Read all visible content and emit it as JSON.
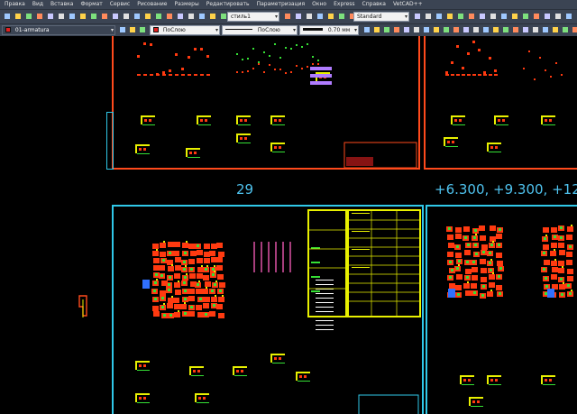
{
  "menu": [
    "Правка",
    "Вид",
    "Вставка",
    "Формат",
    "Сервис",
    "Рисование",
    "Размеры",
    "Редактировать",
    "Параметризация",
    "Окно",
    "Express",
    "Справка",
    "VetCAD++"
  ],
  "toolbar1": {
    "style_combo": "стиль1",
    "standard_combo": "Standard"
  },
  "toolbar2": {
    "layer_combo": "01-armatura",
    "color_combo": "ПоСлою",
    "linetype_combo": "ПоСлою",
    "lineweight_combo": "0.70 мм"
  },
  "drawing": {
    "label_sheet_number": "29",
    "label_elevations": "+6.300, +9.300, +12."
  },
  "colors": {
    "ui_bg": "#3b4453",
    "sheet_orange": "#ff4a1c",
    "sheet_cyan": "#30c8e8",
    "layer_red": "#e02020",
    "table_yellow": "#e8f000",
    "label_blue": "#4fc3ef"
  }
}
